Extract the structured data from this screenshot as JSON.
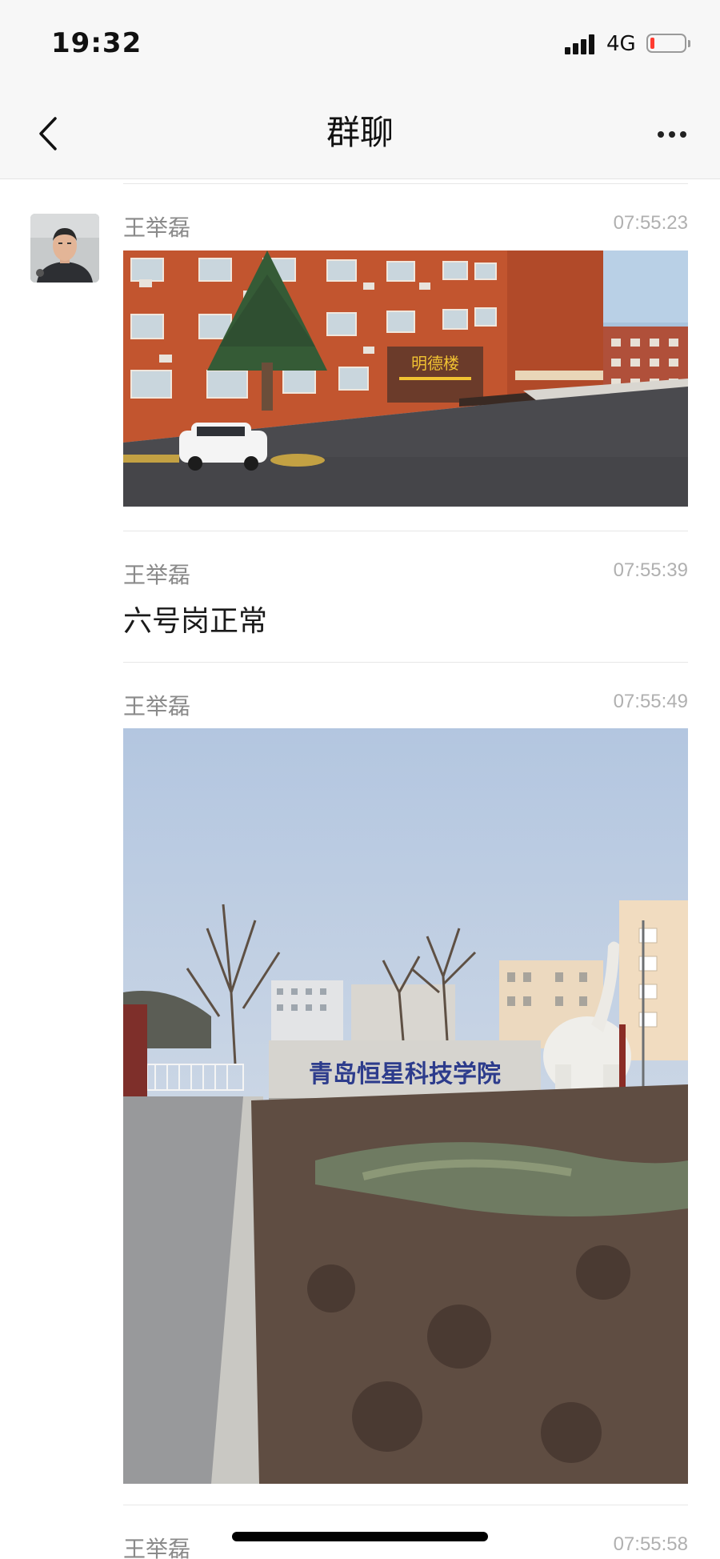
{
  "status_bar": {
    "time": "19:32",
    "network": "4G",
    "battery_level": 0.12,
    "battery_color": "#ff3b30"
  },
  "nav": {
    "title": "群聊"
  },
  "messages": [
    {
      "sender": "王举磊",
      "time": "07:55:23",
      "type": "image",
      "image_label": "明德楼"
    },
    {
      "sender": "王举磊",
      "time": "07:55:39",
      "type": "text",
      "text": "六号岗正常"
    },
    {
      "sender": "王举磊",
      "time": "07:55:49",
      "type": "image",
      "image_label": "青岛恒星科技学院"
    },
    {
      "sender": "王举磊",
      "time": "07:55:58",
      "type": "text"
    }
  ],
  "colors": {
    "sender": "#8a8a8a",
    "timestamp": "#b0b0b0",
    "bar_bg": "#f7f7f7"
  },
  "icons": {
    "back": "chevron-left-icon",
    "more": "more-dots-icon"
  }
}
